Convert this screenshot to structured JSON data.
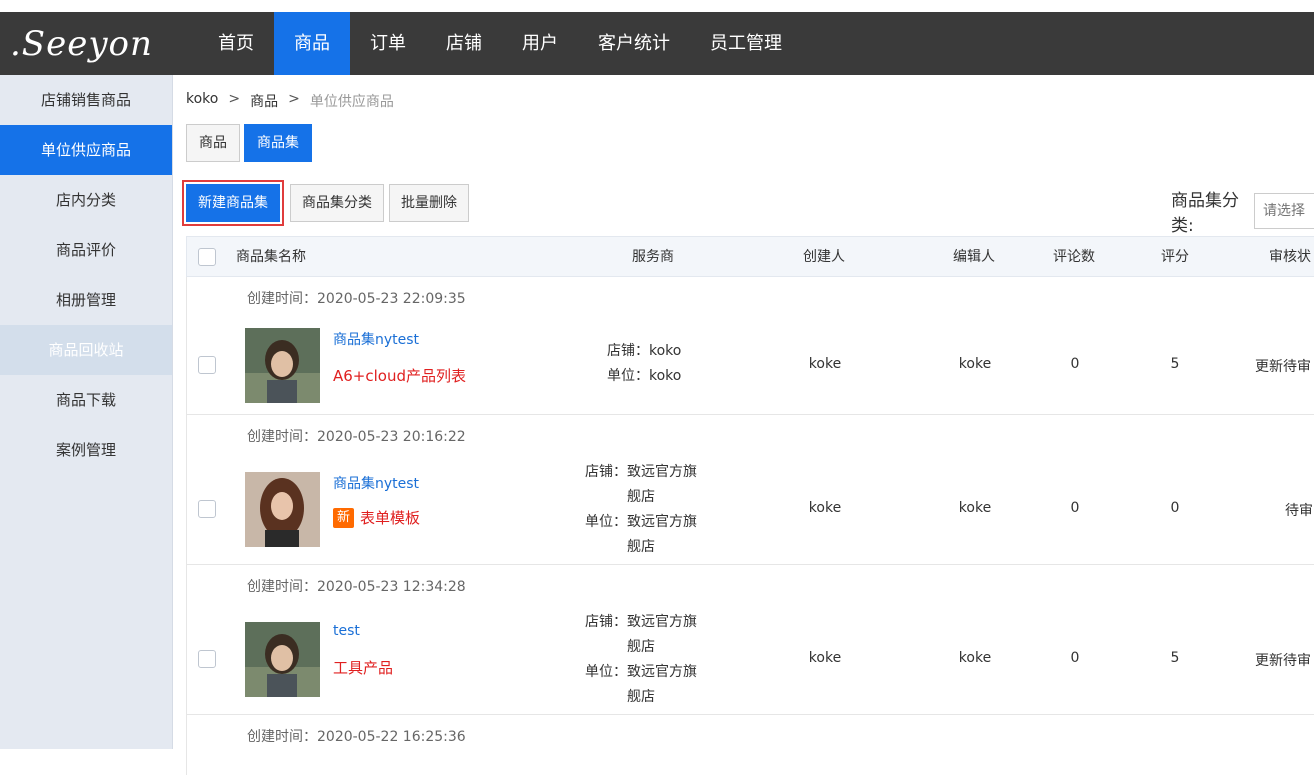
{
  "app": {
    "logo_text": ".Seeyon",
    "nav": [
      {
        "label": "首页",
        "active": false
      },
      {
        "label": "商品",
        "active": true
      },
      {
        "label": "订单",
        "active": false
      },
      {
        "label": "店铺",
        "active": false
      },
      {
        "label": "用户",
        "active": false
      },
      {
        "label": "客户统计",
        "active": false
      },
      {
        "label": "员工管理",
        "active": false
      }
    ]
  },
  "sidebar": {
    "items": [
      {
        "label": "店铺销售商品",
        "state": "normal"
      },
      {
        "label": "单位供应商品",
        "state": "active"
      },
      {
        "label": "店内分类",
        "state": "normal"
      },
      {
        "label": "商品评价",
        "state": "normal"
      },
      {
        "label": "相册管理",
        "state": "normal"
      },
      {
        "label": "商品回收站",
        "state": "muted"
      },
      {
        "label": "商品下载",
        "state": "normal"
      },
      {
        "label": "案例管理",
        "state": "normal"
      }
    ]
  },
  "breadcrumb": {
    "items": [
      "koko",
      "商品",
      "单位供应商品"
    ],
    "sep": ">"
  },
  "tabs": [
    {
      "label": "商品",
      "active": false
    },
    {
      "label": "商品集",
      "active": true
    }
  ],
  "actions": {
    "create": "新建商品集",
    "category": "商品集分类",
    "batch_delete": "批量删除"
  },
  "filter": {
    "label": "商品集分类:",
    "placeholder": "请选择"
  },
  "table": {
    "headers": {
      "name": "商品集名称",
      "provider": "服务商",
      "creator": "创建人",
      "editor": "编辑人",
      "comments": "评论数",
      "score": "评分",
      "status": "审核状"
    },
    "rows": [
      {
        "created_label": "创建时间：",
        "created": "2020-05-23 22:09:35",
        "name": "商品集nytest",
        "badge": "",
        "category": "A6+cloud产品列表",
        "store_label": "店铺：",
        "store_lines": [
          "koko"
        ],
        "unit_label": "单位：",
        "unit_lines": [
          "koko"
        ],
        "creator": "koke",
        "editor": "koke",
        "comments": "0",
        "score": "5",
        "status": "更新待审",
        "thumb": "girl"
      },
      {
        "created_label": "创建时间：",
        "created": "2020-05-23 20:16:22",
        "name": "商品集nytest",
        "badge": "新",
        "category": "表单模板",
        "store_label": "店铺：",
        "store_lines": [
          "致远官方旗",
          "舰店"
        ],
        "unit_label": "单位：",
        "unit_lines": [
          "致远官方旗",
          "舰店"
        ],
        "creator": "koke",
        "editor": "koke",
        "comments": "0",
        "score": "0",
        "status": "待审",
        "thumb": "woman"
      },
      {
        "created_label": "创建时间：",
        "created": "2020-05-23 12:34:28",
        "name": "test",
        "badge": "",
        "category": "工具产品",
        "store_label": "店铺：",
        "store_lines": [
          "致远官方旗",
          "舰店"
        ],
        "unit_label": "单位：",
        "unit_lines": [
          "致远官方旗",
          "舰店"
        ],
        "creator": "koke",
        "editor": "koke",
        "comments": "0",
        "score": "5",
        "status": "更新待审",
        "thumb": "girl"
      },
      {
        "created_label": "创建时间：",
        "created": "2020-05-22 16:25:36"
      }
    ]
  },
  "colors": {
    "primary": "#1572e8",
    "topbar": "#3a3a3a",
    "sidebar": "#e4e9f1",
    "link": "#1a6fd6",
    "danger": "#e02020",
    "badge": "#ff6a00",
    "highlight": "#e03c3c"
  }
}
